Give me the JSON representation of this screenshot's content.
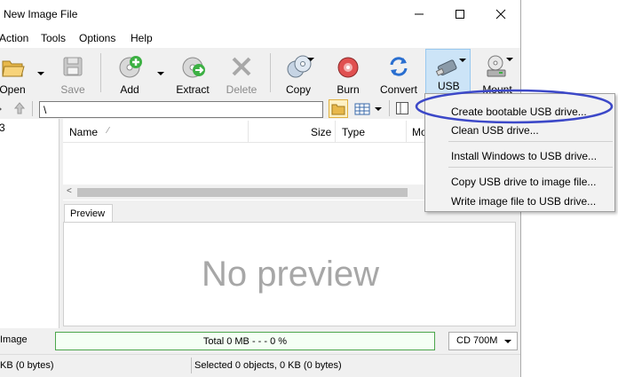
{
  "window": {
    "title": "New Image File",
    "controls": [
      "minimize",
      "maximize",
      "close"
    ]
  },
  "menubar": {
    "items": [
      "Action",
      "Tools",
      "Options",
      "Help"
    ]
  },
  "toolbar": {
    "open_label": "Open",
    "save_label": "Save",
    "add_label": "Add",
    "extract_label": "Extract",
    "delete_label": "Delete",
    "copy_label": "Copy",
    "burn_label": "Burn",
    "convert_label": "Convert",
    "usb_label": "USB",
    "mount_label": "Mount"
  },
  "address": {
    "path": "\\"
  },
  "tree": {
    "root_label": "3"
  },
  "list": {
    "columns": [
      "Name",
      "Size",
      "Type",
      "Mo"
    ]
  },
  "preview": {
    "tab_label": "Preview",
    "empty_text": "No preview"
  },
  "capacity": {
    "image_label": "Image",
    "total_text": "Total  0 MB   - - -  0 %",
    "media_select": "CD 700M"
  },
  "status": {
    "left": "KB (0 bytes)",
    "right": "Selected 0 objects, 0 KB (0 bytes)"
  },
  "usb_menu": {
    "items": [
      "Create bootable USB drive...",
      "Clean USB drive...",
      "Install Windows to USB drive...",
      "Copy USB drive to image file...",
      "Write image file to USB drive..."
    ],
    "highlight_color": "#3c48c8"
  }
}
